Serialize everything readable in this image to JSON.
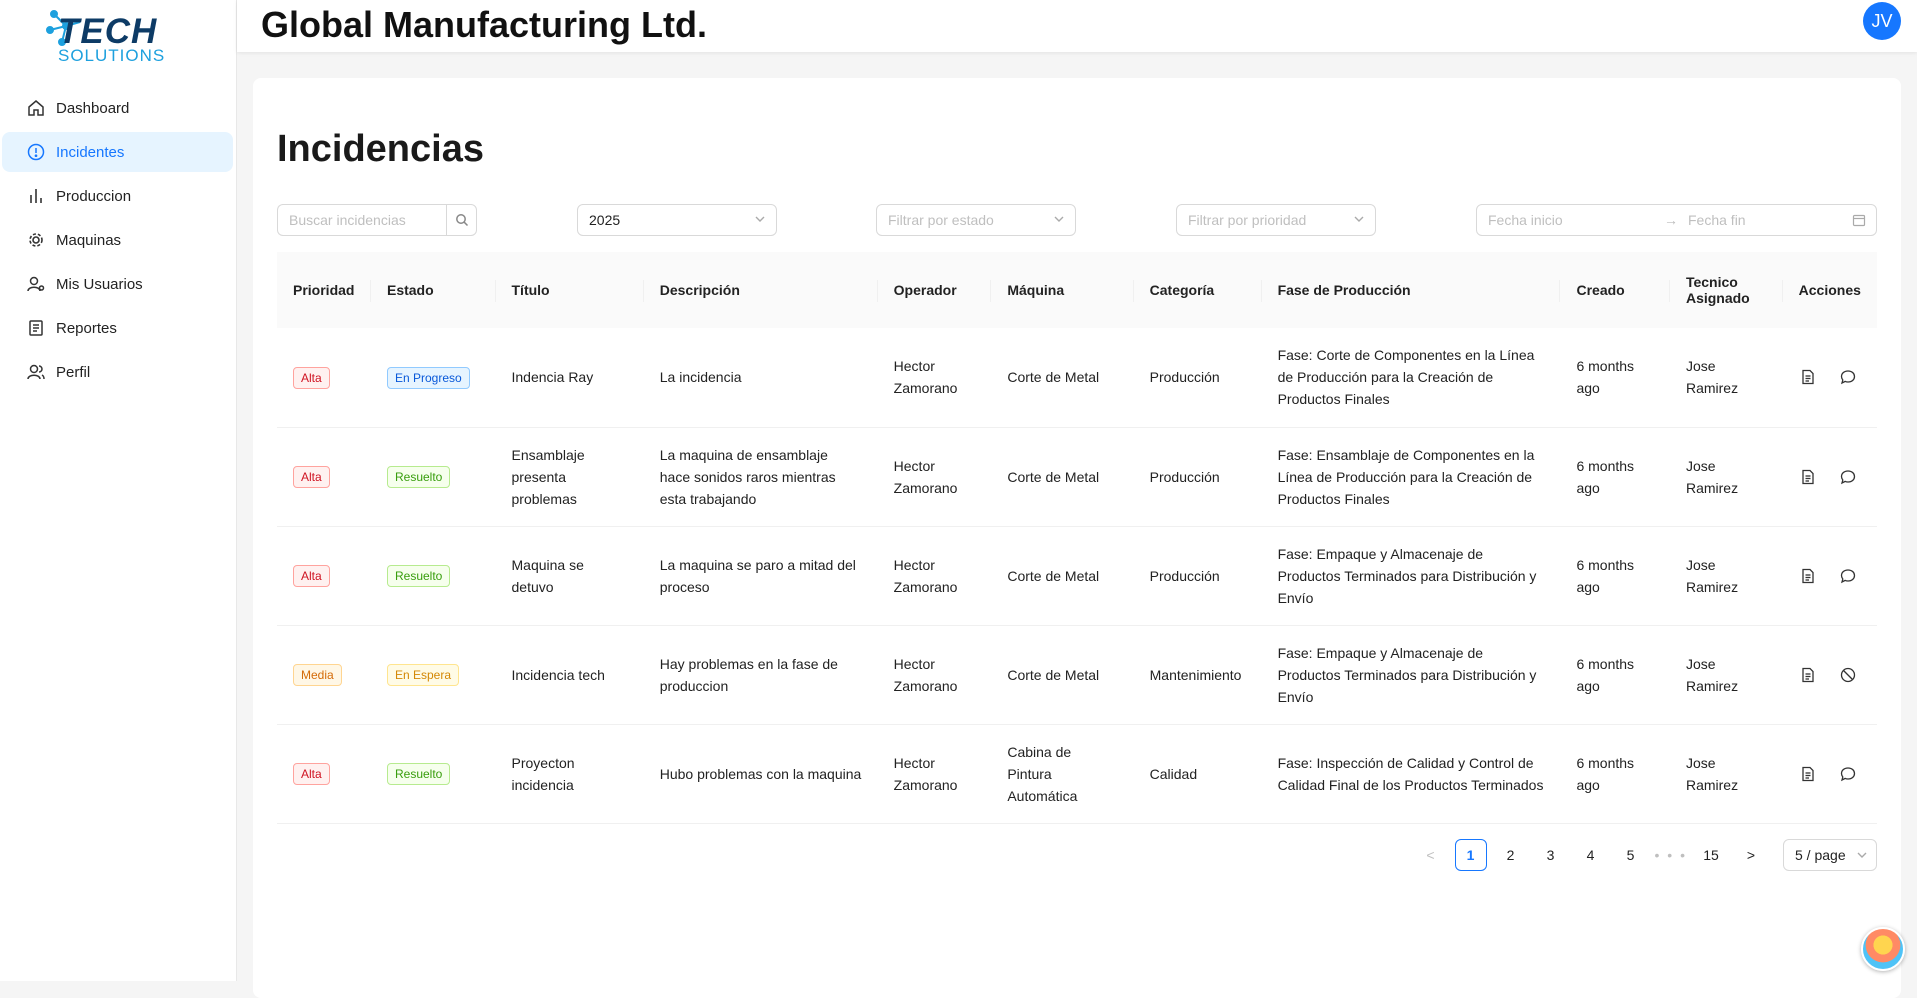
{
  "brand": {
    "logo_line1": "TECH",
    "logo_line2": "SOLUTIONS"
  },
  "header": {
    "company": "Global Manufacturing Ltd.",
    "avatar_initials": "JV"
  },
  "sidebar": {
    "items": [
      {
        "label": "Dashboard",
        "icon": "home-icon"
      },
      {
        "label": "Incidentes",
        "icon": "alert-circle-icon",
        "active": true
      },
      {
        "label": "Produccion",
        "icon": "bar-chart-icon"
      },
      {
        "label": "Maquinas",
        "icon": "gear-icon"
      },
      {
        "label": "Mis Usuarios",
        "icon": "user-settings-icon"
      },
      {
        "label": "Reportes",
        "icon": "report-icon"
      },
      {
        "label": "Perfil",
        "icon": "team-icon"
      }
    ]
  },
  "page": {
    "title": "Incidencias"
  },
  "filters": {
    "search_placeholder": "Buscar incidencias",
    "year_value": "2025",
    "status_placeholder": "Filtrar por estado",
    "priority_placeholder": "Filtrar por prioridad",
    "date_start_placeholder": "Fecha inicio",
    "date_end_placeholder": "Fecha fin"
  },
  "table": {
    "columns": [
      "Prioridad",
      "Estado",
      "Título",
      "Descripción",
      "Operador",
      "Máquina",
      "Categoría",
      "Fase de Producción",
      "Creado",
      "Tecnico Asignado",
      "Acciones"
    ],
    "rows": [
      {
        "priority": "Alta",
        "priority_color": "#cf1322",
        "status": "En Progreso",
        "status_color": "#0958d9",
        "title": "Indencia Ray",
        "description": "La incidencia",
        "operator": "Hector Zamorano",
        "machine": "Corte de Metal",
        "category": "Producción",
        "phase": "Fase: Corte de Componentes en la Línea de Producción para la Creación de Productos Finales",
        "created": "6 months ago",
        "technician": "Jose Ramirez",
        "second_action": "comment-icon"
      },
      {
        "priority": "Alta",
        "priority_color": "#cf1322",
        "status": "Resuelto",
        "status_color": "#389e0d",
        "title": "Ensamblaje presenta problemas",
        "description": "La maquina de ensamblaje hace sonidos raros mientras esta trabajando",
        "operator": "Hector Zamorano",
        "machine": "Corte de Metal",
        "category": "Producción",
        "phase": "Fase: Ensamblaje de Componentes en la Línea de Producción para la Creación de Productos Finales",
        "created": "6 months ago",
        "technician": "Jose Ramirez",
        "second_action": "comment-icon"
      },
      {
        "priority": "Alta",
        "priority_color": "#cf1322",
        "status": "Resuelto",
        "status_color": "#389e0d",
        "title": "Maquina se detuvo",
        "description": "La maquina se paro a mitad del proceso",
        "operator": "Hector Zamorano",
        "machine": "Corte de Metal",
        "category": "Producción",
        "phase": "Fase: Empaque y Almacenaje de Productos Terminados para Distribución y Envío",
        "created": "6 months ago",
        "technician": "Jose Ramirez",
        "second_action": "comment-icon"
      },
      {
        "priority": "Media",
        "priority_color": "#d46b08",
        "status": "En Espera",
        "status_color": "#d48806",
        "title": "Incidencia tech",
        "description": "Hay problemas en la fase de produccion",
        "operator": "Hector Zamorano",
        "machine": "Corte de Metal",
        "category": "Mantenimiento",
        "phase": "Fase: Empaque y Almacenaje de Productos Terminados para Distribución y Envío",
        "created": "6 months ago",
        "technician": "Jose Ramirez",
        "second_action": "block-icon"
      },
      {
        "priority": "Alta",
        "priority_color": "#cf1322",
        "status": "Resuelto",
        "status_color": "#389e0d",
        "title": "Proyecton incidencia",
        "description": "Hubo problemas con la maquina",
        "operator": "Hector Zamorano",
        "machine": "Cabina de Pintura Automática",
        "category": "Calidad",
        "phase": "Fase: Inspección de Calidad y Control de Calidad Final de los Productos Terminados",
        "created": "6 months ago",
        "technician": "Jose Ramirez",
        "second_action": "comment-icon"
      }
    ]
  },
  "pagination": {
    "prev": "<",
    "next": ">",
    "pages": [
      "1",
      "2",
      "3",
      "4",
      "5"
    ],
    "ellipsis": "• • •",
    "last": "15",
    "current": "1",
    "page_size": "5 / page"
  },
  "colors": {
    "accent": "#1677ff",
    "active_bg": "#e6f4ff"
  }
}
